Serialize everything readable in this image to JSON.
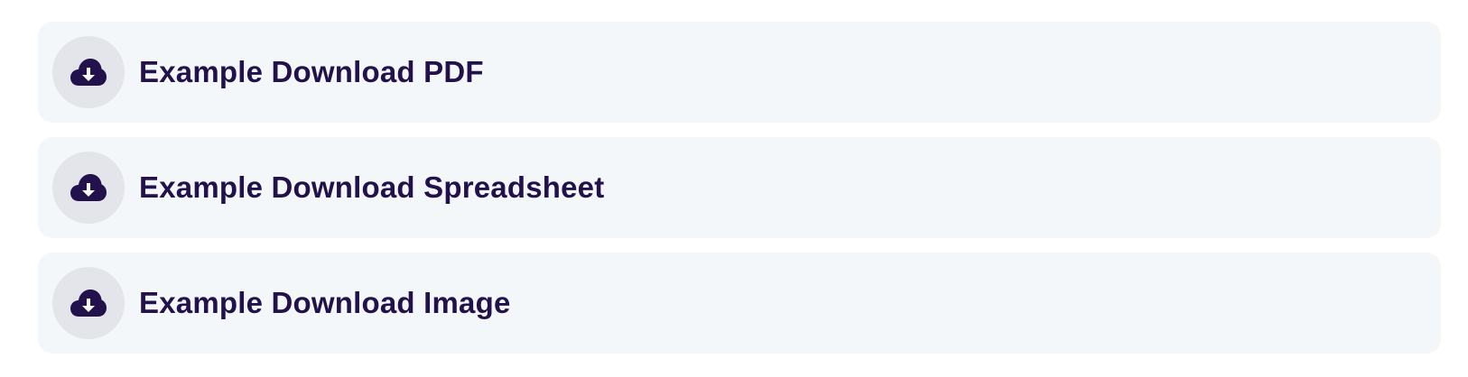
{
  "downloads": {
    "items": [
      {
        "label": "Example Download PDF",
        "icon": "cloud-download-icon"
      },
      {
        "label": "Example Download Spreadsheet",
        "icon": "cloud-download-icon"
      },
      {
        "label": "Example Download Image",
        "icon": "cloud-download-icon"
      }
    ]
  },
  "colors": {
    "card_background": "#f4f7fa",
    "icon_circle": "#e4e5ea",
    "text": "#22114a"
  }
}
